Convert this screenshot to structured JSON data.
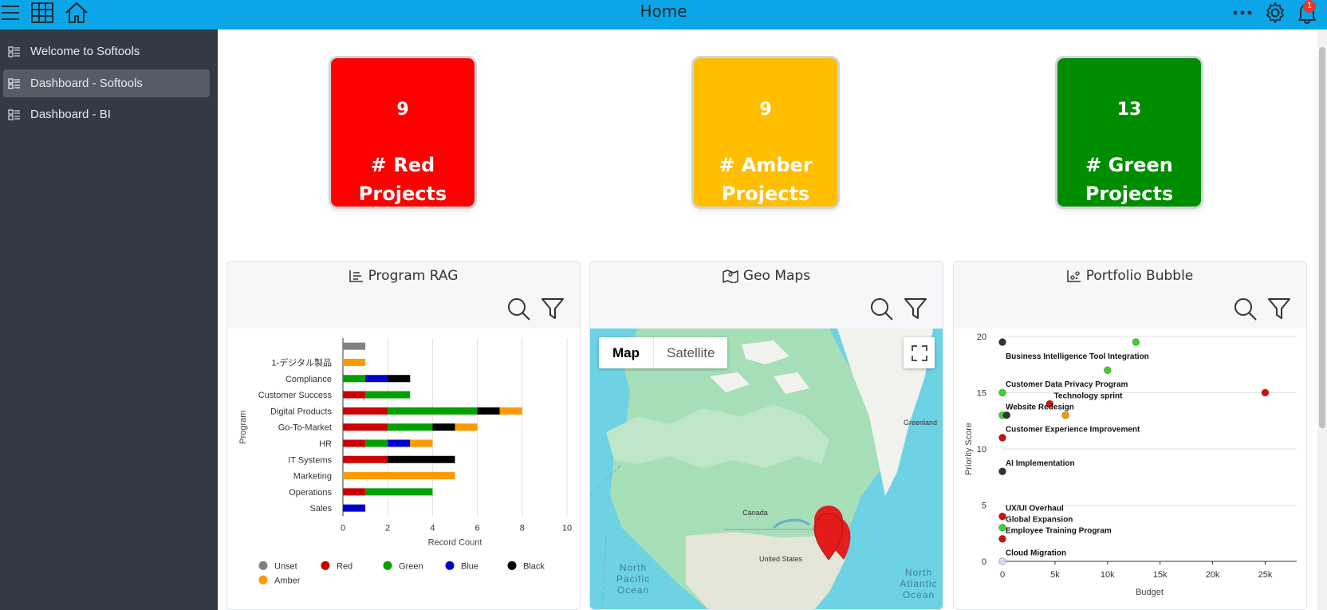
{
  "header": {
    "title": "Home",
    "notification_count": "1"
  },
  "icons": [
    "menu-icon",
    "grid-icon",
    "home-icon",
    "more-icon",
    "gear-icon",
    "bell-icon"
  ],
  "colors": {
    "topbar": "#0ba6e8",
    "sidebar": "#343a45",
    "red": "#ff0000",
    "amber": "#ffbf00",
    "green": "#008e00"
  },
  "sidebar": {
    "items": [
      {
        "label": "Welcome to Softools",
        "active": false
      },
      {
        "label": "Dashboard - Softools",
        "active": true
      },
      {
        "label": "Dashboard - BI",
        "active": false
      }
    ]
  },
  "kpis": [
    {
      "value": "9",
      "label": "# Red Projects",
      "color": "#ff0000"
    },
    {
      "value": "9",
      "label": "# Amber Projects",
      "color": "#ffbf00"
    },
    {
      "value": "13",
      "label": "# Green Projects",
      "color": "#008e00"
    }
  ],
  "cards": {
    "program_rag": {
      "title": "Program RAG"
    },
    "geo_maps": {
      "title": "Geo Maps",
      "map_tab": "Map",
      "satellite_tab": "Satellite",
      "labels": {
        "greenland": "Greenland",
        "canada": "Canada",
        "us": "United States",
        "npo1": "North",
        "npo2": "Pacific",
        "npo3": "Ocean",
        "nao1": "North",
        "nao2": "Atlantic",
        "nao3": "Ocean"
      }
    },
    "portfolio_bubble": {
      "title": "Portfolio Bubble"
    }
  },
  "chart_data": [
    {
      "type": "bar",
      "orientation": "horizontal-stacked",
      "categories": [
        "",
        "1-デジタル製品",
        "Compliance",
        "Customer Success",
        "Digital Products",
        "Go-To-Market",
        "HR",
        "IT Systems",
        "Marketing",
        "Operations",
        "Sales"
      ],
      "series": [
        {
          "name": "Unset",
          "color": "#808080",
          "values": [
            1,
            0,
            0,
            0,
            0,
            0,
            0,
            0,
            0,
            0,
            0
          ]
        },
        {
          "name": "Red",
          "color": "#cc0000",
          "values": [
            0,
            0,
            0,
            1,
            2,
            2,
            1,
            2,
            0,
            1,
            0
          ]
        },
        {
          "name": "Green",
          "color": "#00a000",
          "values": [
            0,
            0,
            1,
            2,
            4,
            2,
            1,
            0,
            0,
            3,
            0
          ]
        },
        {
          "name": "Blue",
          "color": "#0000cc",
          "values": [
            0,
            0,
            1,
            0,
            0,
            0,
            1,
            0,
            0,
            0,
            1
          ]
        },
        {
          "name": "Black",
          "color": "#000000",
          "values": [
            0,
            0,
            1,
            0,
            1,
            1,
            0,
            3,
            0,
            0,
            0
          ]
        },
        {
          "name": "Amber",
          "color": "#ff9900",
          "values": [
            0,
            1,
            0,
            0,
            1,
            1,
            1,
            0,
            5,
            0,
            0
          ]
        }
      ],
      "xlabel": "Record Count",
      "ylabel": "Program",
      "xlim": [
        0,
        10
      ],
      "xticks": [
        "0",
        "2",
        "4",
        "6",
        "8",
        "10"
      ],
      "grid": true,
      "legend": "bottom"
    },
    {
      "type": "scatter",
      "xlabel": "Budget",
      "ylabel": "Priority Score",
      "xlim": [
        0,
        28000
      ],
      "ylim": [
        0,
        20
      ],
      "xticks": [
        "0",
        "5k",
        "10k",
        "15k",
        "20k",
        "25k"
      ],
      "yticks": [
        "0",
        "5",
        "10",
        "15",
        "20"
      ],
      "points": [
        {
          "x": 0,
          "y": 19.5,
          "color": "#333333"
        },
        {
          "x": 12700,
          "y": 19.5,
          "color": "#44cc33"
        },
        {
          "x": 10000,
          "y": 17,
          "color": "#44cc33"
        },
        {
          "x": 0,
          "y": 15,
          "color": "#44cc33"
        },
        {
          "x": 25000,
          "y": 15,
          "color": "#cc1111"
        },
        {
          "x": 4500,
          "y": 14,
          "color": "#cc1111"
        },
        {
          "x": 0,
          "y": 13,
          "color": "#44cc33"
        },
        {
          "x": 400,
          "y": 13,
          "color": "#333333"
        },
        {
          "x": 6000,
          "y": 13,
          "color": "#ee9a11"
        },
        {
          "x": 0,
          "y": 11,
          "color": "#cc1111"
        },
        {
          "x": 0,
          "y": 8,
          "color": "#333333"
        },
        {
          "x": 0,
          "y": 4,
          "color": "#cc1111"
        },
        {
          "x": 0,
          "y": 3,
          "color": "#44cc33"
        },
        {
          "x": 0,
          "y": 2,
          "color": "#cc1111"
        },
        {
          "x": 0,
          "y": 0,
          "color": "#d6d6f0"
        }
      ],
      "labels": [
        {
          "text": "Business Intelligence Tool Integration",
          "x": 300,
          "y": 18.3
        },
        {
          "text": "Customer Data Privacy Program",
          "x": 300,
          "y": 15.8
        },
        {
          "text": "Technology sprint",
          "x": 4900,
          "y": 14.8
        },
        {
          "text": "Website Redesign",
          "x": 300,
          "y": 13.8
        },
        {
          "text": "Customer Experience Improvement",
          "x": 300,
          "y": 11.8
        },
        {
          "text": "AI Implementation",
          "x": 300,
          "y": 8.8
        },
        {
          "text": "UX/UI Overhaul",
          "x": 300,
          "y": 4.8
        },
        {
          "text": "Global Expansion",
          "x": 300,
          "y": 3.8
        },
        {
          "text": "Employee Training Program",
          "x": 300,
          "y": 2.8
        },
        {
          "text": "Cloud Migration",
          "x": 300,
          "y": 0.8
        }
      ],
      "grid": true
    }
  ]
}
